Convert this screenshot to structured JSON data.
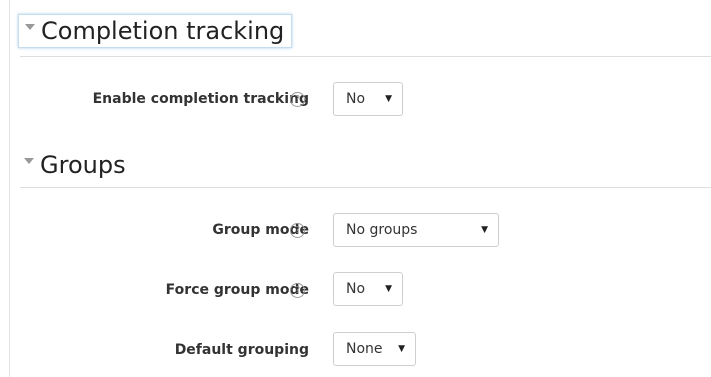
{
  "sections": {
    "completion": {
      "title": "Completion tracking",
      "fields": {
        "enable_tracking": {
          "label": "Enable completion tracking",
          "value": "No",
          "help": "?"
        }
      }
    },
    "groups": {
      "title": "Groups",
      "fields": {
        "group_mode": {
          "label": "Group mode",
          "value": "No groups",
          "help": "?"
        },
        "force_group_mode": {
          "label": "Force group mode",
          "value": "No",
          "help": "?"
        },
        "default_grouping": {
          "label": "Default grouping",
          "value": "None"
        }
      }
    }
  },
  "icons": {
    "section_toggle": "caret-down-icon",
    "help": "question-circle-icon",
    "dropdown": "dropdown-arrow-icon"
  },
  "dropdown_arrow_glyph": "▼",
  "colors": {
    "focus_outline": "#c5dcec",
    "divider": "#dedede",
    "help_icon": "#9a9a9a"
  }
}
